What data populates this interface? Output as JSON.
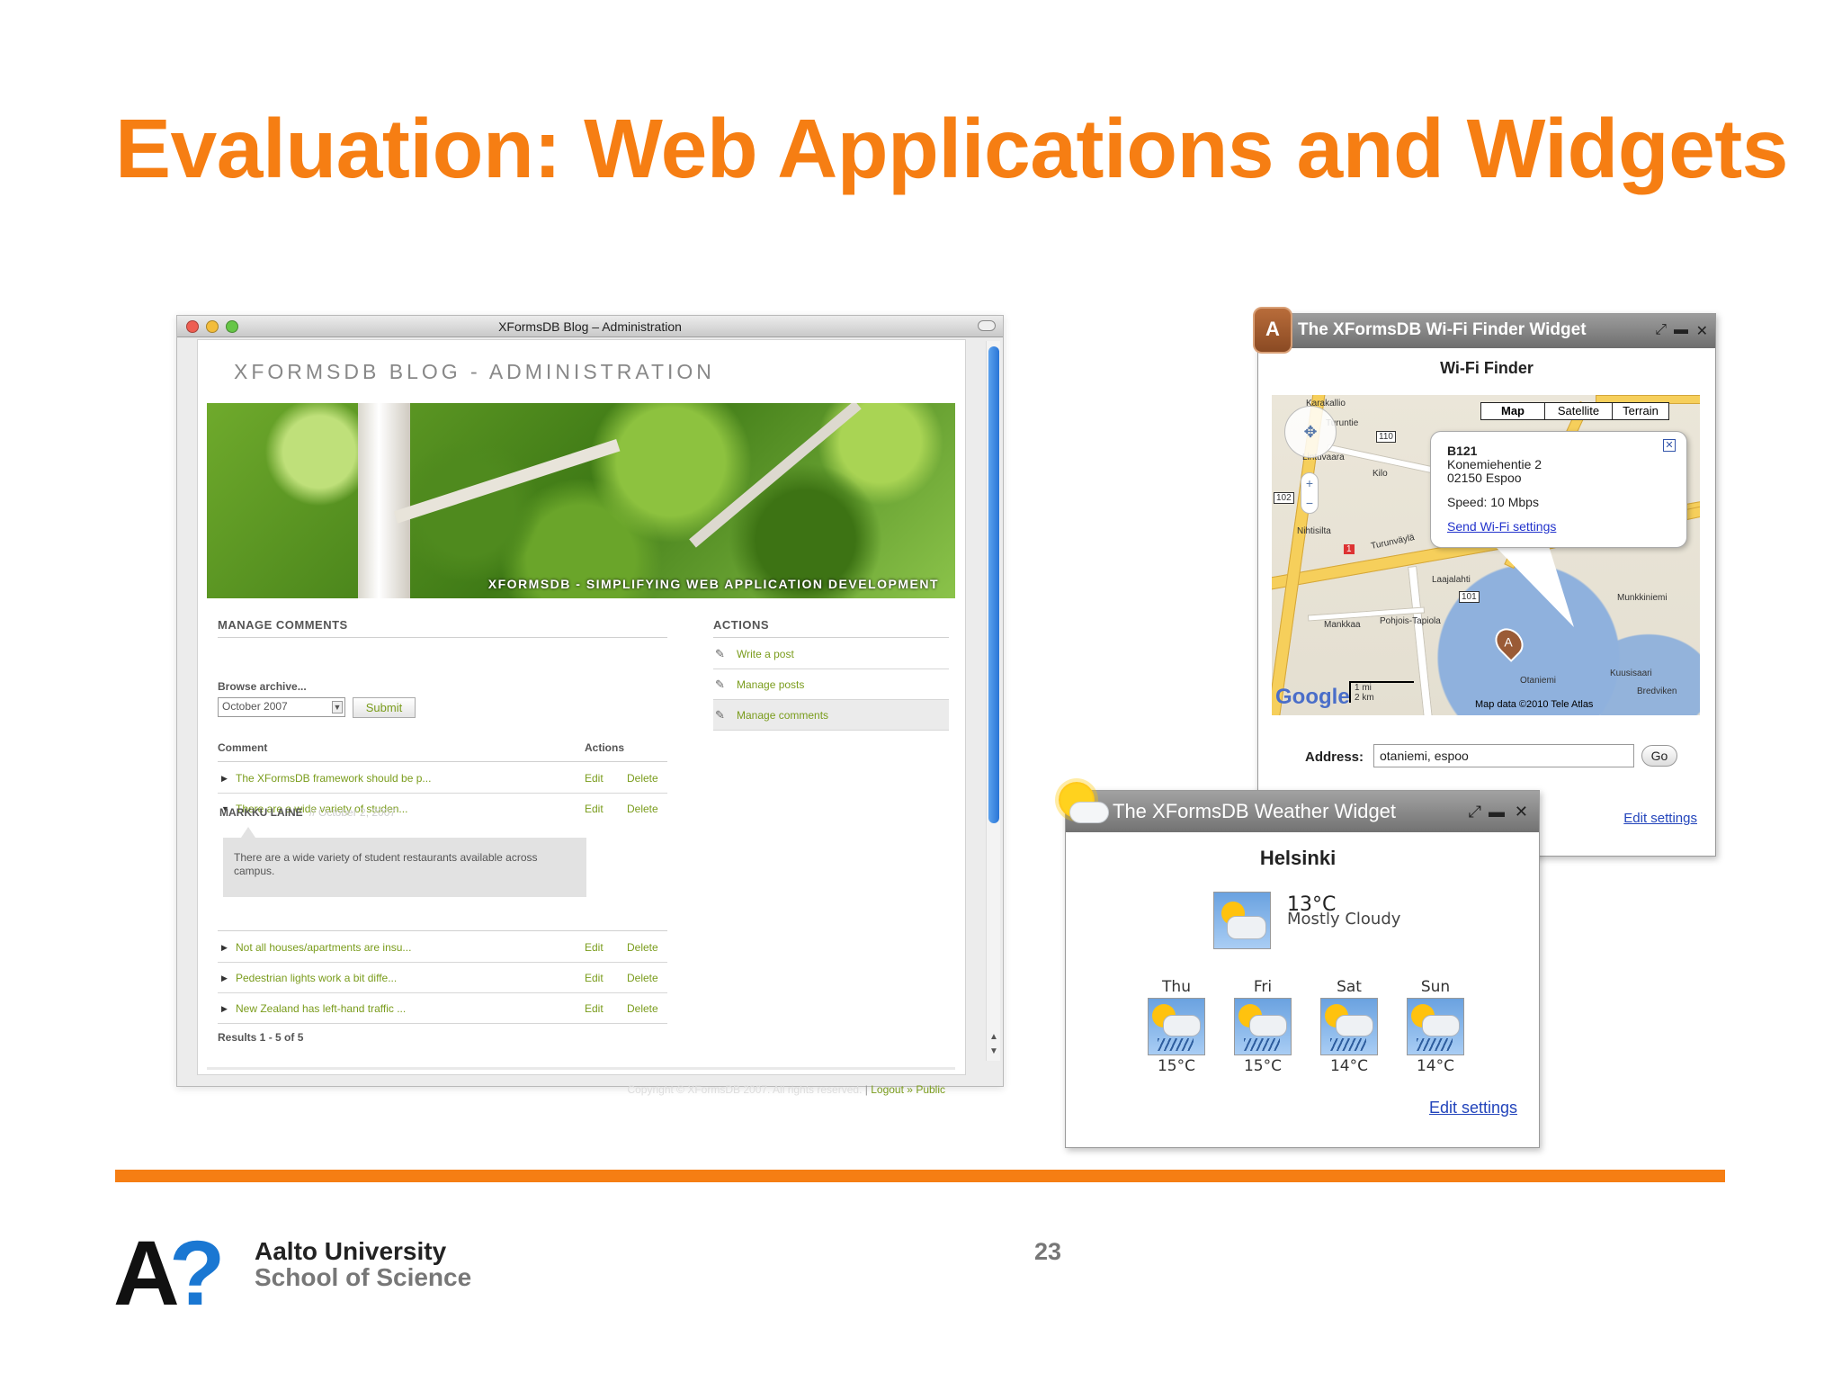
{
  "slide": {
    "title": "Evaluation: Web Applications and Widgets",
    "page_number": "23",
    "university": "Aalto University",
    "school": "School of Science",
    "accent_color": "#f67e13"
  },
  "blog_window": {
    "window_title": "XFormsDB Blog – Administration",
    "heading": "XFORMSDB BLOG - ADMINISTRATION",
    "banner_caption": "XFORMSDB - SIMPLIFYING WEB APPLICATION DEVELOPMENT",
    "manage_comments": {
      "title": "MANAGE COMMENTS",
      "browse_label": "Browse archive...",
      "archive_value": "October 2007",
      "submit_label": "Submit",
      "col_comment": "Comment",
      "col_actions": "Actions",
      "rows": [
        {
          "text": "The XFormsDB framework should be p...",
          "edit": "Edit",
          "delete": "Delete"
        },
        {
          "text": "There are a wide variety of studen...",
          "edit": "Edit",
          "delete": "Delete"
        },
        {
          "text": "Not all houses/apartments are insu...",
          "edit": "Edit",
          "delete": "Delete"
        },
        {
          "text": "Pedestrian lights work a bit diffe...",
          "edit": "Edit",
          "delete": "Delete"
        },
        {
          "text": "New Zealand has left-hand traffic ...",
          "edit": "Edit",
          "delete": "Delete"
        }
      ],
      "expanded_author": "MARKKU LAINE",
      "expanded_date": "// October 2, 2007",
      "expanded_body": "There are a wide variety of student restaurants available across campus.",
      "results": "Results  1 - 5 of 5"
    },
    "actions": {
      "title": "ACTIONS",
      "items": [
        "Write a post",
        "Manage posts",
        "Manage comments"
      ]
    },
    "footer": {
      "copyright": "Copyright © XFormsDB 2007. All rights reserved.",
      "separator": "|",
      "logout": "Logout",
      "sep2": "»",
      "public": "Public"
    }
  },
  "wifi_widget": {
    "title": "The XFormsDB Wi-Fi Finder Widget",
    "heading": "Wi-Fi Finder",
    "map_types": [
      "Map",
      "Satellite",
      "Terrain"
    ],
    "selected_map_type": "Map",
    "info": {
      "name": "B121",
      "street": "Konemiehentie 2",
      "city": "02150 Espoo",
      "speed": "Speed: 10 Mbps",
      "link": "Send Wi-Fi settings"
    },
    "map_labels": [
      "Karakallio",
      "Turuntie",
      "Lintuvaara",
      "Kilo",
      "Nihtisilta",
      "Turunväylä",
      "Laajalahti",
      "Mankkaa",
      "Pohjois-Tapiola",
      "Otaniemi",
      "Kuusisaari",
      "Munkkiniemi",
      "Bredviken",
      "110",
      "102",
      "101",
      "1"
    ],
    "scale_mi": "1 mi",
    "scale_km": "2 km",
    "map_data": "Map data ©2010 Tele Atlas",
    "google": "Google",
    "address_label": "Address:",
    "address_value": "otaniemi, espoo",
    "go_label": "Go",
    "edit_settings": "Edit settings"
  },
  "weather_widget": {
    "title": "The XFormsDB Weather Widget",
    "city": "Helsinki",
    "current_temp": "13°C",
    "current_condition": "Mostly Cloudy",
    "forecast": [
      {
        "day": "Thu",
        "temp": "15°C"
      },
      {
        "day": "Fri",
        "temp": "15°C"
      },
      {
        "day": "Sat",
        "temp": "14°C"
      },
      {
        "day": "Sun",
        "temp": "14°C"
      }
    ],
    "edit_settings": "Edit settings"
  }
}
